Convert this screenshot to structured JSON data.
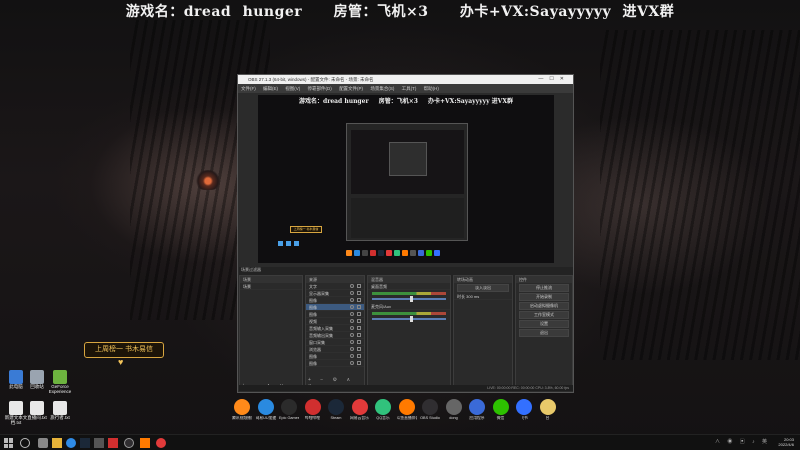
{
  "headline": {
    "game": "游戏名：dread hunger",
    "admin": "房管：飞机×3",
    "card": "办卡+VX:Sayayyyyy 进VX群"
  },
  "promo": {
    "text": "上周榜一 书木易信",
    "heart": "♥"
  },
  "desktop_icons": [
    {
      "label": "此电脑",
      "color": "#3a7bd5"
    },
    {
      "label": "回收站",
      "color": "#9aa4b0"
    },
    {
      "label": "GeForce Experience",
      "color": "#6db33f"
    },
    {
      "label": "新建文本文档.txt",
      "color": "#e8e8e8"
    },
    {
      "label": "直播间.txt",
      "color": "#e8e8e8"
    },
    {
      "label": "旅行者.txt",
      "color": "#e8e8e8"
    }
  ],
  "obs": {
    "title": "OBS 27.1.3 (64-bit, windows) - 配置文件: 未命名 - 场景: 未命名",
    "menu": [
      "文件(F)",
      "编辑(E)",
      "视图(V)",
      "停靠部件(D)",
      "配置文件(P)",
      "场景集合(S)",
      "工具(T)",
      "帮助(H)"
    ],
    "preview_headline": {
      "game": "游戏名：dread hunger",
      "admin": "房管：飞机×3",
      "card": "办卡+VX:Sayayyyyy 进VX群"
    },
    "mini_promo": "上周榜一 书木易信",
    "scene_filter": "场景过滤器",
    "docks": {
      "scenes": {
        "title": "场景",
        "items": [
          "场景"
        ]
      },
      "sources": {
        "title": "来源",
        "items": [
          "文字",
          "显示器采集",
          "图像",
          "图像",
          "图像",
          "视频",
          "音频输入采集",
          "音频输出采集",
          "窗口采集",
          "浏览器",
          "图像",
          "图像"
        ]
      },
      "mixer": {
        "title": "混音器",
        "channels": [
          "桌面音频",
          "麦克风/Aux"
        ]
      },
      "transitions": {
        "title": "转场动画",
        "type": "淡入淡出",
        "duration_label": "时长",
        "duration": "300 ms"
      },
      "controls": {
        "title": "控件",
        "buttons": [
          "停止推流",
          "开始录制",
          "启动虚拟摄像机",
          "工作室模式",
          "设置",
          "退出"
        ]
      }
    },
    "status": "LIVE: 00:00:00   REC: 00:00:00   CPU: 3.8%, 60.00 fps"
  },
  "apps": [
    {
      "label": "腾讯视频播放",
      "color": "#ff8a1a"
    },
    {
      "label": "网易UU加速器",
      "color": "#2a8ae0"
    },
    {
      "label": "Epic Games Launcher",
      "color": "#2b2b2b"
    },
    {
      "label": "哔哩哔哩",
      "color": "#d12f2f"
    },
    {
      "label": "Steam",
      "color": "#1b2838"
    },
    {
      "label": "网易云音乐",
      "color": "#e23a3a"
    },
    {
      "label": "QQ音乐",
      "color": "#31c27c"
    },
    {
      "label": "斗鱼直播伴侣",
      "color": "#ff7a00"
    },
    {
      "label": "OBS Studio",
      "color": "#302e31"
    },
    {
      "label": "dong",
      "color": "#666666"
    },
    {
      "label": "应用程序",
      "color": "#3a6ad8"
    },
    {
      "label": "微信",
      "color": "#2dc100"
    },
    {
      "label": "飞书",
      "color": "#3370ff"
    },
    {
      "label": "台",
      "color": "#e8c96a"
    }
  ],
  "taskbar": {
    "clock_time": "20:03",
    "clock_date": "2022/4/6"
  }
}
